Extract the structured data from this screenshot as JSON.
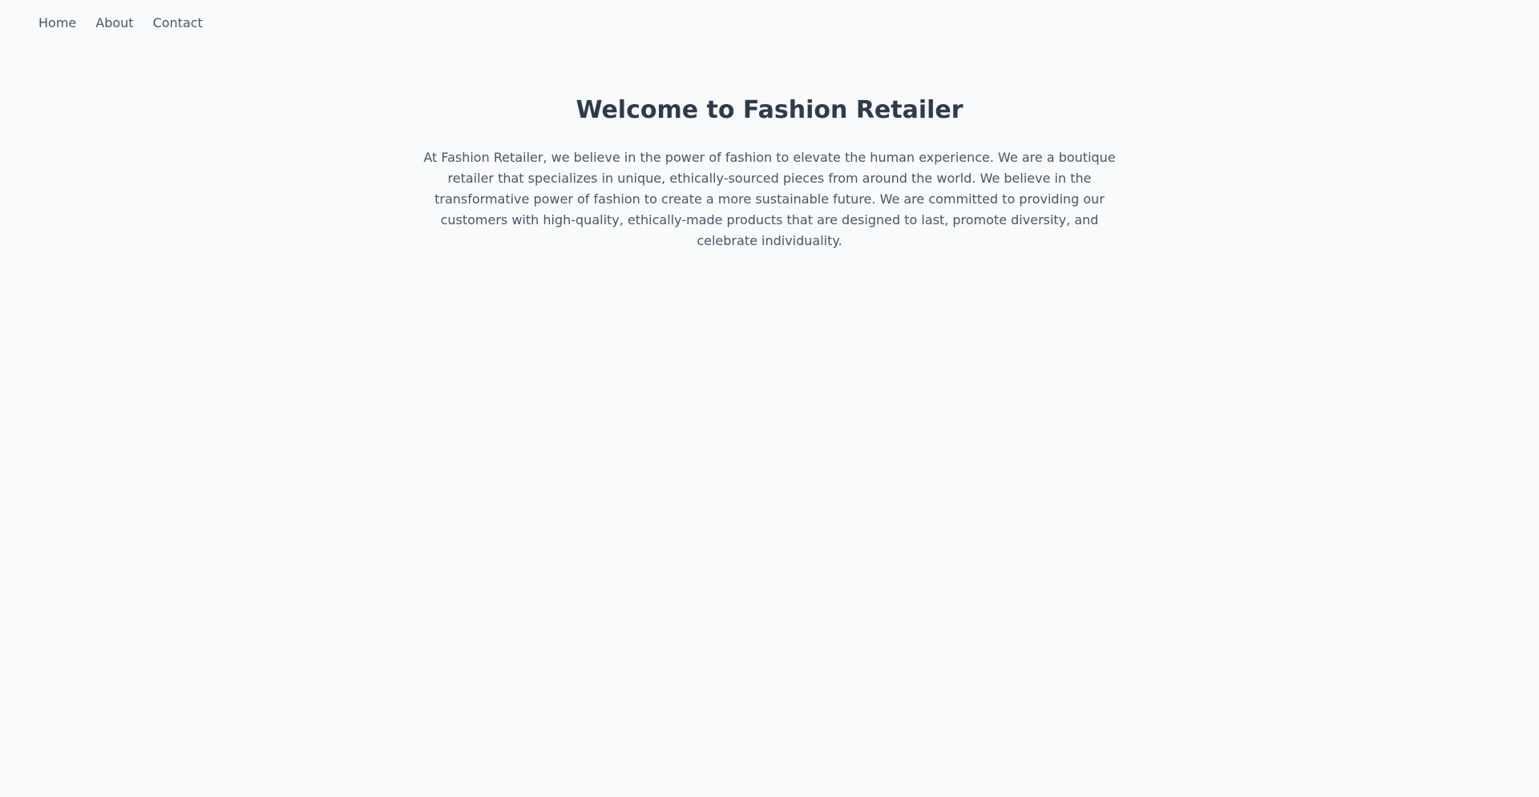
{
  "nav": {
    "items": [
      {
        "label": "Home"
      },
      {
        "label": "About"
      },
      {
        "label": "Contact"
      }
    ]
  },
  "hero": {
    "title": "Welcome to Fashion Retailer",
    "description": "At Fashion Retailer, we believe in the power of fashion to elevate the human experience. We are a boutique retailer that specializes in unique, ethically-sourced pieces from around the world. We believe in the transformative power of fashion to create a more sustainable future. We are committed to providing our customers with high-quality, ethically-made products that are designed to last, promote diversity, and celebrate individuality."
  }
}
